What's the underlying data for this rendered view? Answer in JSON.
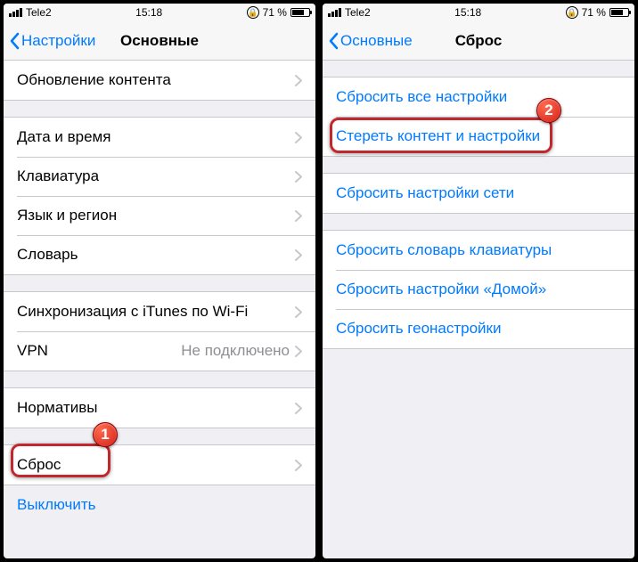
{
  "status": {
    "carrier": "Tele2",
    "time": "15:18",
    "battery_pct": "71 %"
  },
  "left": {
    "back": "Настройки",
    "title": "Основные",
    "group1": {
      "content_update": "Обновление контента"
    },
    "group2": {
      "datetime": "Дата и время",
      "keyboard": "Клавиатура",
      "language": "Язык и регион",
      "dictionary": "Словарь"
    },
    "group3": {
      "itunes_wifi": "Синхронизация с iTunes по Wi-Fi",
      "vpn": "VPN",
      "vpn_status": "Не подключено"
    },
    "group4": {
      "regulatory": "Нормативы"
    },
    "group5": {
      "reset": "Сброс"
    },
    "shutdown": "Выключить"
  },
  "right": {
    "back": "Основные",
    "title": "Сброс",
    "group1": {
      "reset_all": "Сбросить все настройки",
      "erase_all": "Стереть контент и настройки"
    },
    "group2": {
      "reset_network": "Сбросить настройки сети"
    },
    "group3": {
      "reset_keyboard": "Сбросить словарь клавиатуры",
      "reset_home": "Сбросить настройки «Домой»",
      "reset_location": "Сбросить геонастройки"
    }
  },
  "annotations": {
    "step1": "1",
    "step2": "2"
  }
}
